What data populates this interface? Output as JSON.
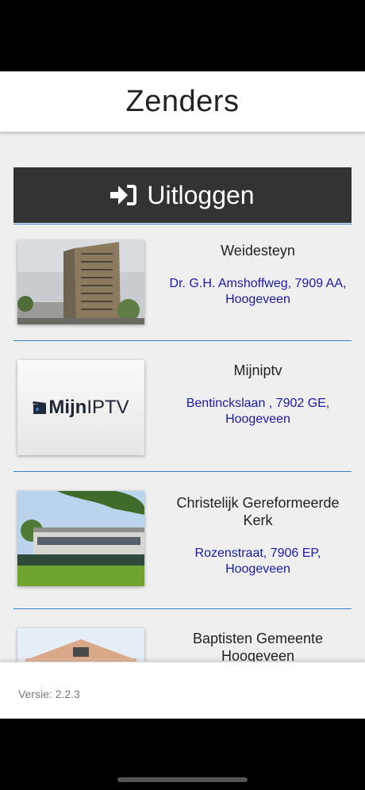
{
  "header": {
    "title": "Zenders"
  },
  "logout": {
    "label": "Uitloggen",
    "icon": "sign-in-arrow-icon"
  },
  "channels": [
    {
      "name": "Weidesteyn",
      "address": "Dr. G.H. Amshoffweg, 7909 AA, Hoogeveen",
      "thumb": "building-photo"
    },
    {
      "name": "Mijniptv",
      "address": "Bentinckslaan , 7902 GE, Hoogeveen",
      "thumb_logo_bold": "Mijn",
      "thumb_logo_light": "IPTV"
    },
    {
      "name": "Christelijk Gereformeerde Kerk",
      "address": "Rozenstraat, 7906 EP, Hoogeveen",
      "thumb": "church-photo"
    },
    {
      "name": "Baptisten Gemeente Hoogeveen",
      "address": "",
      "thumb": "church-facade-photo"
    }
  ],
  "footer": {
    "version": "Versie: 2.2.3"
  },
  "colors": {
    "logout_bg": "#333333",
    "address": "#1a1aa8",
    "divider": "#3b7dc4",
    "background": "#efefef"
  }
}
